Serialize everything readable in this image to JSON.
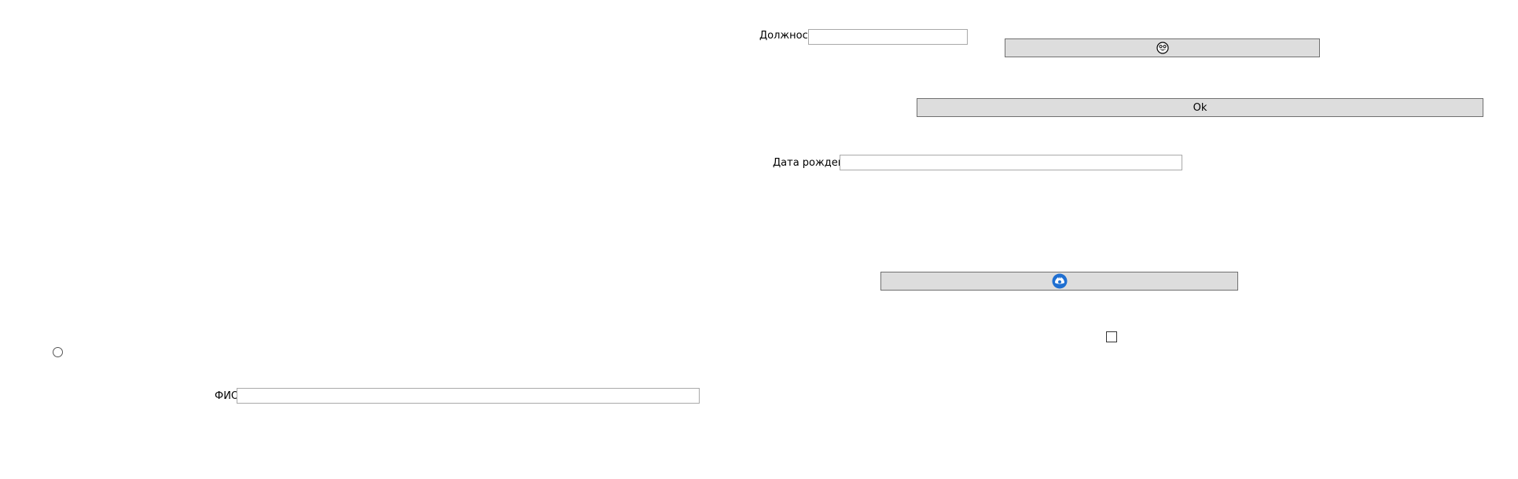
{
  "form": {
    "position_label": "Должность",
    "position_value": "",
    "birthdate_label": "Дата рождения",
    "birthdate_value": "",
    "fullname_label": "ФИО",
    "fullname_value": "",
    "ok_label": "Ok",
    "emoji_button_icon": "smiley-face-icon",
    "logo_button_icon": "blue-circle-logo-icon",
    "radio_checked": false,
    "checkbox_checked": false
  },
  "colors": {
    "button_bg": "#dddddd",
    "button_border": "#707070",
    "input_border": "#a9a9a9",
    "logo_blue": "#1f6fd1"
  }
}
